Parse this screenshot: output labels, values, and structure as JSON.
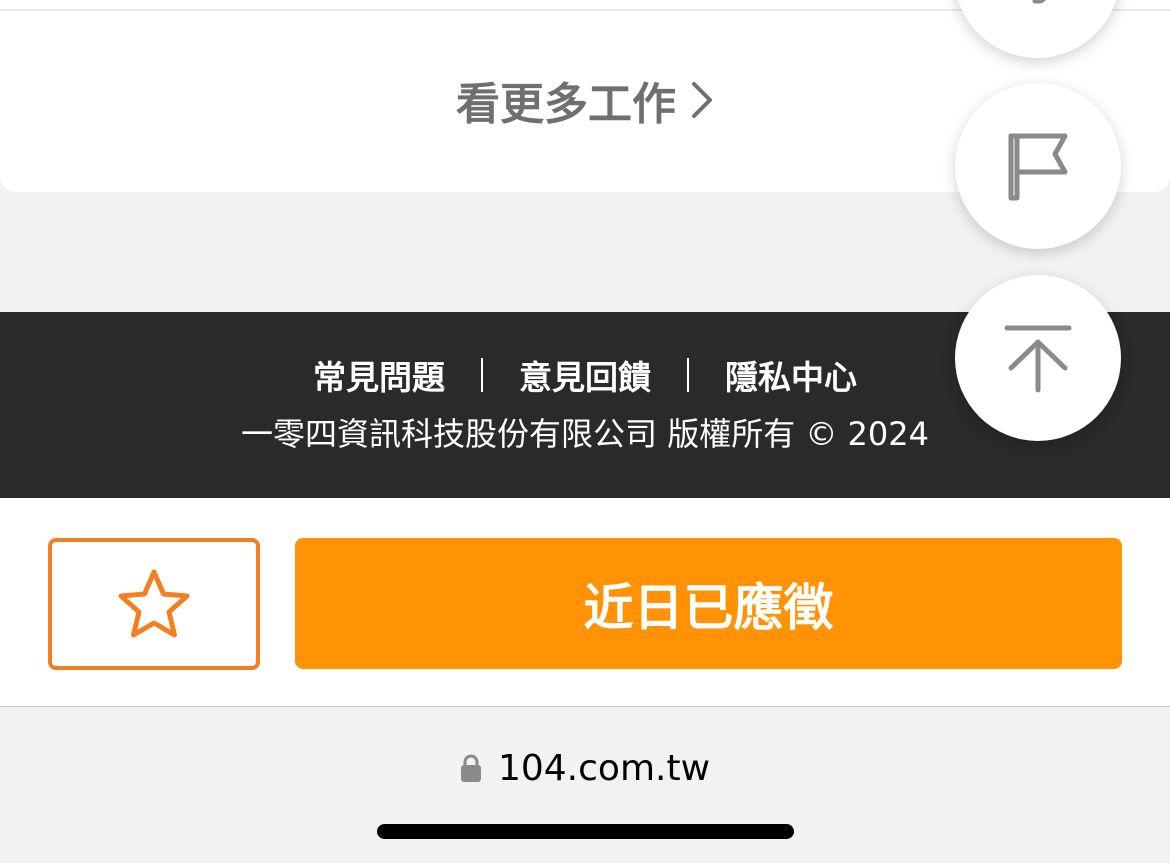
{
  "job_list": {
    "more_jobs_label": "看更多工作"
  },
  "footer": {
    "links": [
      {
        "label": "常見問題"
      },
      {
        "label": "意見回饋"
      },
      {
        "label": "隱私中心"
      }
    ],
    "copyright": "一零四資訊科技股份有限公司 版權所有 © 2024"
  },
  "action_bar": {
    "favorite_icon": "star-outline-icon",
    "apply_label": "近日已應徵"
  },
  "floating_buttons": {
    "partial_icon": "unknown-icon",
    "report_icon": "flag-icon",
    "scroll_top_icon": "arrow-up-to-top-icon"
  },
  "browser": {
    "url": "104.com.tw",
    "lock_icon": "lock-icon"
  },
  "colors": {
    "accent_orange": "#ff9205",
    "favorite_border": "#f47f20",
    "footer_bg": "#2a2a2a",
    "page_bg": "#f2f2f2"
  }
}
